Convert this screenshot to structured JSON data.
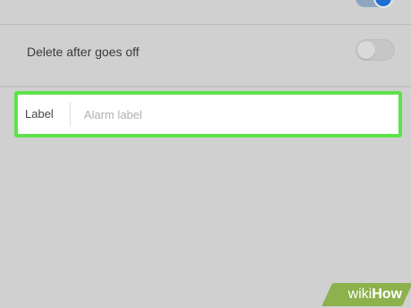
{
  "settings": {
    "delete_after_label": "Delete after goes off",
    "delete_after_enabled": false,
    "top_row_toggle_enabled": true
  },
  "label_field": {
    "label": "Label",
    "placeholder": "Alarm label",
    "value": ""
  },
  "watermark": {
    "wiki": "wiki",
    "how": "How"
  },
  "colors": {
    "highlight": "#5de24a",
    "toggle_on": "#1f6fd1",
    "watermark_bg": "#8cb14d"
  }
}
